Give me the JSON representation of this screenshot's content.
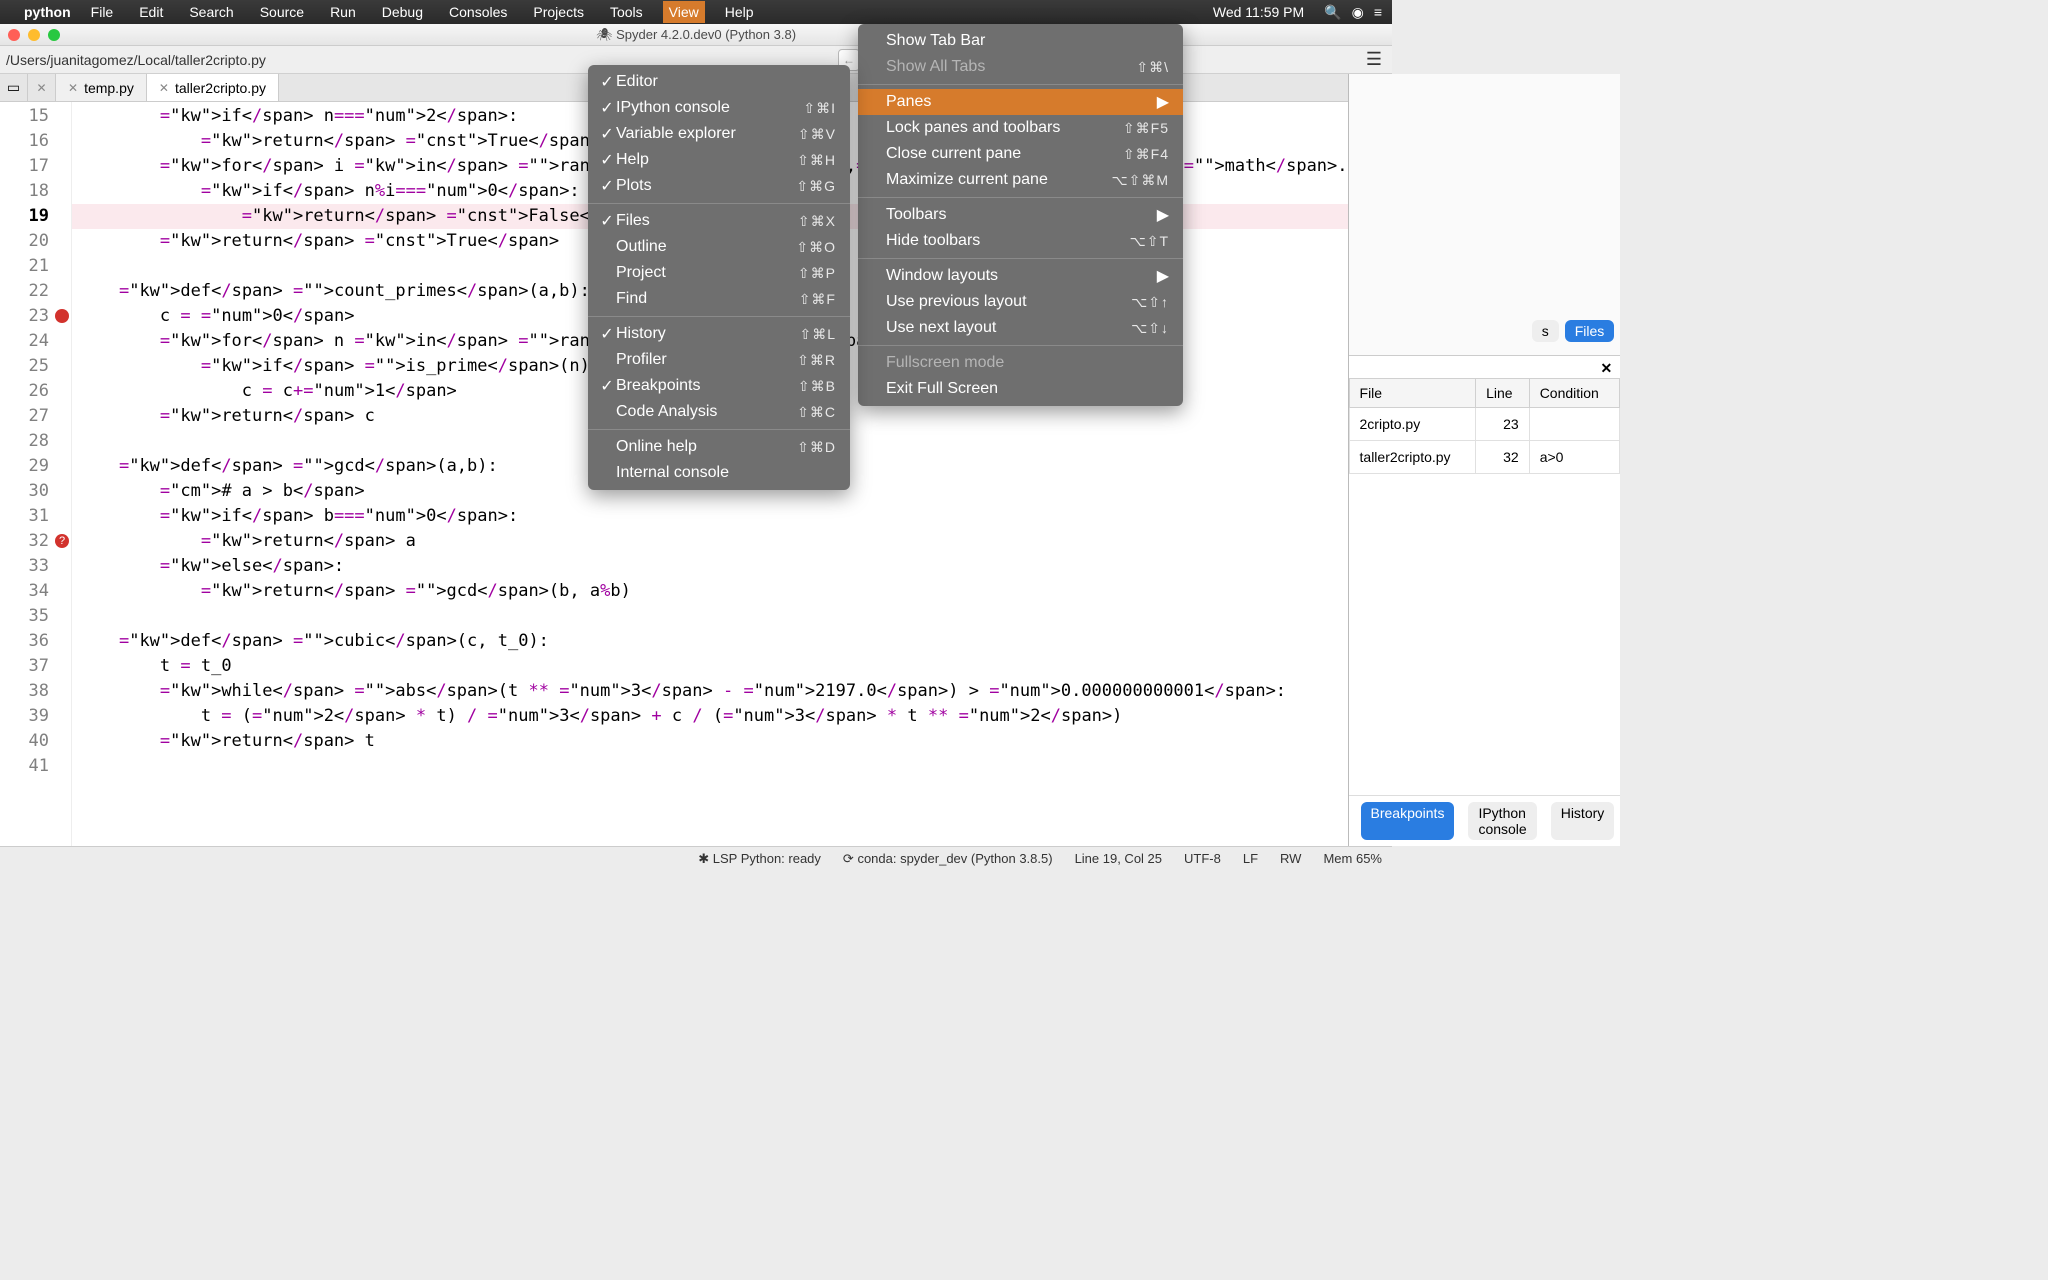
{
  "menubar": {
    "app": "python",
    "items": [
      "File",
      "Edit",
      "Search",
      "Source",
      "Run",
      "Debug",
      "Consoles",
      "Projects",
      "Tools",
      "View",
      "Help"
    ],
    "open": "View",
    "clock": "Wed 11:59 PM"
  },
  "titlebar": {
    "title": "Spyder 4.2.0.dev0 (Python 3.8)"
  },
  "pathbar": {
    "path": "/Users/juanitagomez/Local/taller2cripto.py"
  },
  "tabs": [
    {
      "label": "temp.py",
      "active": false
    },
    {
      "label": "taller2cripto.py",
      "active": true
    }
  ],
  "code": {
    "first_line": 15,
    "current_line": 19,
    "breakpoints": [
      23
    ],
    "warnings": [
      32
    ],
    "lines": [
      "        if n==2:",
      "            return True",
      "        for i in range(2,math.ceil(math.",
      "            if n%i==0:",
      "                return False",
      "        return True",
      "",
      "    def count_primes(a,b):",
      "        c = 0",
      "        for n in range(a,b+1):",
      "            if is_prime(n):",
      "                c = c+1",
      "        return c",
      "",
      "    def gcd(a,b):",
      "        # a > b",
      "        if b==0:",
      "            return a",
      "        else:",
      "            return gcd(b, a%b)",
      "",
      "    def cubic(c, t_0):",
      "        t = t_0",
      "        while abs(t ** 3 - 2197.0) > 0.000000000001:",
      "            t = (2 * t) / 3 + c / (3 * t ** 2)",
      "        return t",
      ""
    ]
  },
  "right": {
    "top_tabs": {
      "cutoff": "s",
      "active": "Files"
    },
    "bp_headers": [
      "File",
      "Line",
      "Condition"
    ],
    "bp_rows": [
      {
        "file": "2cripto.py",
        "line": "23",
        "cond": ""
      },
      {
        "file": "taller2cripto.py",
        "line": "32",
        "cond": "a>0"
      }
    ],
    "bottom_tabs": [
      "Breakpoints",
      "IPython console",
      "History"
    ],
    "bottom_active": "Breakpoints"
  },
  "status": {
    "lsp": "LSP Python: ready",
    "conda": "conda: spyder_dev (Python 3.8.5)",
    "pos": "Line 19, Col 25",
    "enc": "UTF-8",
    "eol": "LF",
    "rw": "RW",
    "mem": "Mem 65%"
  },
  "view_menu": [
    {
      "label": "Show Tab Bar",
      "type": "item"
    },
    {
      "label": "Show All Tabs",
      "sc": "⇧⌘\\",
      "type": "item",
      "disabled": true
    },
    {
      "type": "sep"
    },
    {
      "label": "Panes",
      "type": "sub",
      "selected": true
    },
    {
      "label": "Lock panes and toolbars",
      "sc": "⇧⌘F5",
      "type": "item"
    },
    {
      "label": "Close current pane",
      "sc": "⇧⌘F4",
      "type": "item"
    },
    {
      "label": "Maximize current pane",
      "sc": "⌥⇧⌘M",
      "type": "item"
    },
    {
      "type": "sep"
    },
    {
      "label": "Toolbars",
      "type": "sub"
    },
    {
      "label": "Hide toolbars",
      "sc": "⌥⇧T",
      "type": "item"
    },
    {
      "type": "sep"
    },
    {
      "label": "Window layouts",
      "type": "sub"
    },
    {
      "label": "Use previous layout",
      "sc": "⌥⇧↑",
      "type": "item"
    },
    {
      "label": "Use next layout",
      "sc": "⌥⇧↓",
      "type": "item"
    },
    {
      "type": "sep"
    },
    {
      "label": "Fullscreen mode",
      "type": "item",
      "disabled": true
    },
    {
      "label": "Exit Full Screen",
      "type": "item"
    }
  ],
  "panes_menu": [
    {
      "label": "Editor",
      "checked": true
    },
    {
      "label": "IPython console",
      "sc": "⇧⌘I",
      "checked": true
    },
    {
      "label": "Variable explorer",
      "sc": "⇧⌘V",
      "checked": true
    },
    {
      "label": "Help",
      "sc": "⇧⌘H",
      "checked": true
    },
    {
      "label": "Plots",
      "sc": "⇧⌘G",
      "checked": true
    },
    {
      "type": "sep"
    },
    {
      "label": "Files",
      "sc": "⇧⌘X",
      "checked": true
    },
    {
      "label": "Outline",
      "sc": "⇧⌘O"
    },
    {
      "label": "Project",
      "sc": "⇧⌘P"
    },
    {
      "label": "Find",
      "sc": "⇧⌘F"
    },
    {
      "type": "sep"
    },
    {
      "label": "History",
      "sc": "⇧⌘L",
      "checked": true
    },
    {
      "label": "Profiler",
      "sc": "⇧⌘R"
    },
    {
      "label": "Breakpoints",
      "sc": "⇧⌘B",
      "checked": true
    },
    {
      "label": "Code Analysis",
      "sc": "⇧⌘C"
    },
    {
      "type": "sep"
    },
    {
      "label": "Online help",
      "sc": "⇧⌘D"
    },
    {
      "label": "Internal console"
    }
  ]
}
